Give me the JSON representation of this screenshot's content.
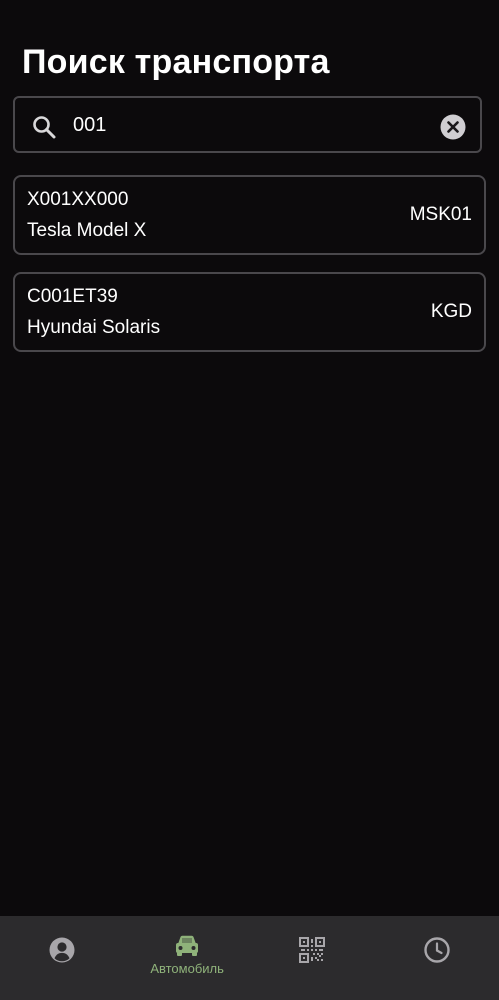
{
  "header": {
    "title": "Поиск транспорта"
  },
  "search": {
    "value": "001",
    "search_icon": "search-icon",
    "clear_icon": "clear-icon"
  },
  "results": [
    {
      "plate": "X001XX000",
      "model": "Tesla Model X",
      "region": "MSK01"
    },
    {
      "plate": "C001ET39",
      "model": "Hyundai Solaris",
      "region": "KGD"
    }
  ],
  "nav": {
    "items": [
      {
        "icon": "profile-icon",
        "label": "",
        "active": false
      },
      {
        "icon": "car-icon",
        "label": "Автомобиль",
        "active": true
      },
      {
        "icon": "qr-code-icon",
        "label": "",
        "active": false
      },
      {
        "icon": "clock-icon",
        "label": "",
        "active": false
      }
    ]
  },
  "colors": {
    "background": "#0c0a0c",
    "border": "#4a484c",
    "nav_background": "#2c2b2d",
    "icon_gray": "#a8a6aa",
    "accent_green": "#8fb27a"
  }
}
